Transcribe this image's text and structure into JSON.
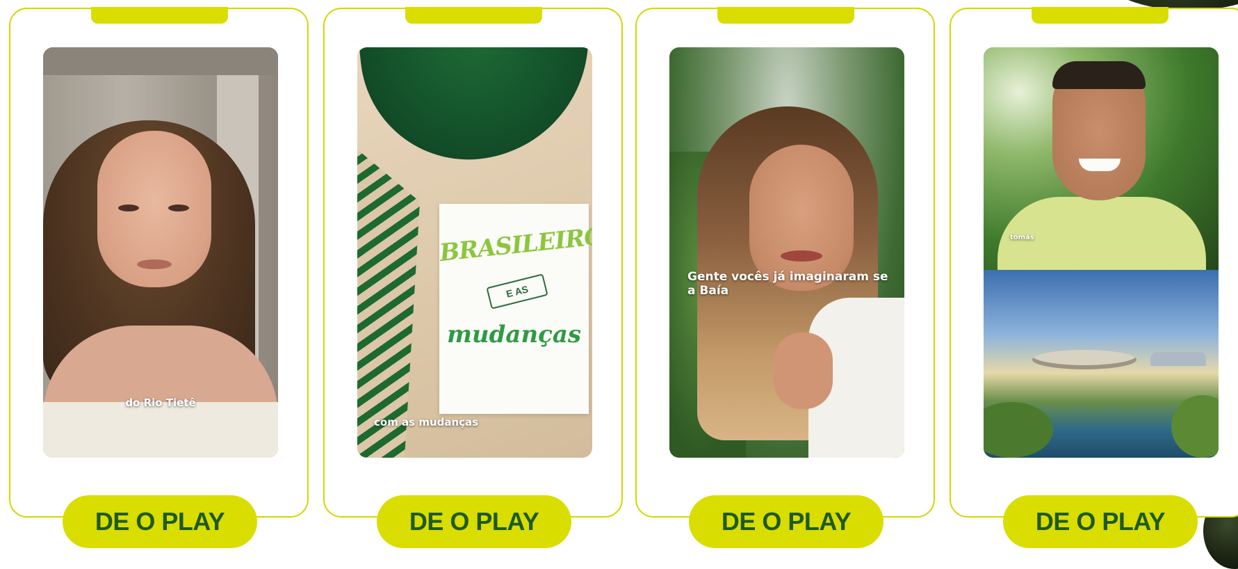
{
  "cards": [
    {
      "caption": "do Rio Tietê",
      "button_label": "DE O PLAY"
    },
    {
      "caption": "com as mudanças",
      "card_text_line1": "BRASILEIROS",
      "card_text_line2": "E AS",
      "card_text_line3": "mudanças",
      "button_label": "DE O PLAY"
    },
    {
      "caption": "Gente vocês já imaginaram se a Baía",
      "button_label": "DE O PLAY"
    },
    {
      "shirt_text": "tomás",
      "button_label": "DE O PLAY"
    }
  ],
  "colors": {
    "accent": "#d9dd00",
    "card_border": "#d3d600",
    "button_text": "#1e5a22"
  }
}
